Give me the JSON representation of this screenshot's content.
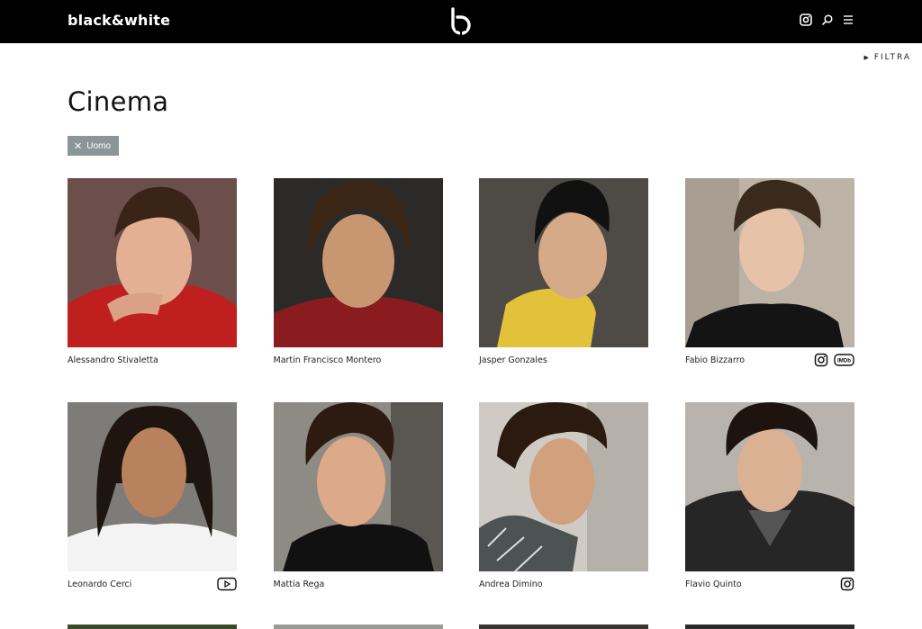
{
  "header": {
    "brand": "black&white",
    "icons": [
      "instagram-icon",
      "search-icon",
      "menu-icon"
    ]
  },
  "filter_toggle": "FILTRA",
  "page_title": "Cinema",
  "active_filter": {
    "label": "Uomo",
    "remove_icon": "close-icon"
  },
  "talents": [
    {
      "name": "Alessandro Stivaletta",
      "social": []
    },
    {
      "name": "Martin Francisco Montero",
      "social": []
    },
    {
      "name": "Jasper Gonzales",
      "social": []
    },
    {
      "name": "Fabio Bizzarro",
      "social": [
        "instagram-icon",
        "imdb-icon"
      ]
    },
    {
      "name": "Leonardo Cerci",
      "social": [
        "youtube-icon"
      ]
    },
    {
      "name": "Mattia Rega",
      "social": []
    },
    {
      "name": "Andrea Dimino",
      "social": []
    },
    {
      "name": "Flavio Quinto",
      "social": [
        "instagram-icon"
      ]
    }
  ],
  "imdb_label": "IMDb",
  "colors": {
    "header_bg": "#000000",
    "chip_bg": "#8c9598",
    "text": "#222222"
  }
}
